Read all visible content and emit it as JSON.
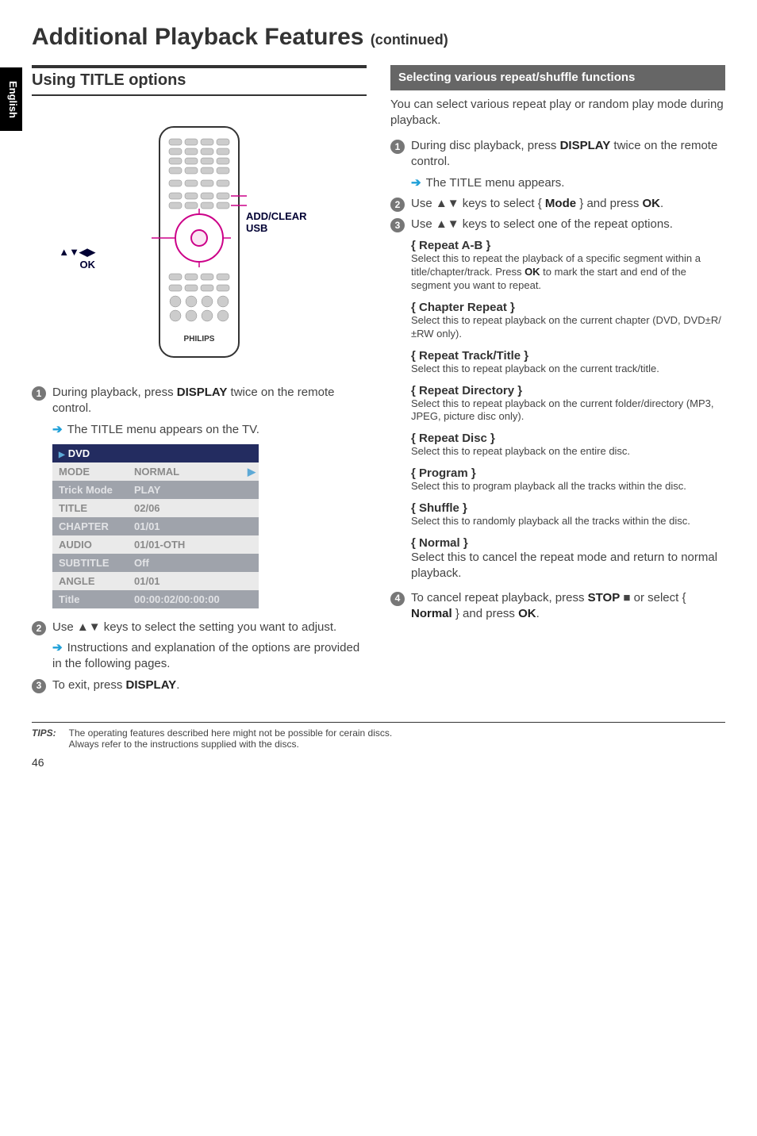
{
  "sideTab": "English",
  "pageTitle": "Additional Playback Features",
  "pageTitleCont": "(continued)",
  "left": {
    "heading": "Using TITLE options",
    "labelRight1": "ADD/CLEAR",
    "labelRight2": "USB",
    "labelLeft1": "▲▼◀▶",
    "labelLeft2": "OK",
    "remoteBrand": "PHILIPS",
    "step1_a": "During playback, press ",
    "step1_b": "DISPLAY",
    "step1_c": " twice on the remote control.",
    "step1_sub": "The TITLE menu appears on the TV.",
    "table": {
      "hdr": "DVD",
      "rows": [
        {
          "k": "MODE",
          "v": "NORMAL",
          "cls": "dvd-row-light",
          "arrow": true
        },
        {
          "k": "Trick Mode",
          "v": "PLAY",
          "cls": "dvd-row-dark"
        },
        {
          "k": "TITLE",
          "v": "02/06",
          "cls": "dvd-row-light"
        },
        {
          "k": "CHAPTER",
          "v": "01/01",
          "cls": "dvd-row-dark"
        },
        {
          "k": "AUDIO",
          "v": "01/01-OTH",
          "cls": "dvd-row-light"
        },
        {
          "k": "SUBTITLE",
          "v": "Off",
          "cls": "dvd-row-dark"
        },
        {
          "k": "ANGLE",
          "v": "01/01",
          "cls": "dvd-row-light"
        },
        {
          "k": "Title",
          "v": "00:00:02/00:00:00",
          "cls": "dvd-row-dark"
        }
      ]
    },
    "step2_a": "Use ▲▼ keys to select the setting you want to adjust.",
    "step2_sub": "Instructions and explanation of the options are provided in the following pages.",
    "step3_a": "To exit, press ",
    "step3_b": "DISPLAY",
    "step3_c": "."
  },
  "right": {
    "subhead": "Selecting various repeat/shuffle functions",
    "intro": "You can select various repeat play or random play mode during playback.",
    "step1_a": "During disc playback, press ",
    "step1_b": "DISPLAY",
    "step1_c": " twice on the remote control.",
    "step1_sub": "The TITLE menu appears.",
    "step2_a": "Use ▲▼ keys to select { ",
    "step2_b": "Mode",
    "step2_c": " } and press ",
    "step2_d": "OK",
    "step2_e": ".",
    "step3": "Use ▲▼ keys to select one of the repeat options.",
    "opts": [
      {
        "t": "{ Repeat A-B }",
        "d": "Select this to repeat the playback of a specific segment within a title/chapter/track. Press OK to mark the start and end of the segment you want to repeat.",
        "lg": false,
        "bold": "OK"
      },
      {
        "t": "{ Chapter Repeat }",
        "d": "Select this to repeat playback on the current chapter (DVD, DVD±R/±RW only).",
        "lg": false
      },
      {
        "t": "{ Repeat Track/Title }",
        "d": "Select this to repeat playback on the current track/title.",
        "lg": false
      },
      {
        "t": "{ Repeat Directory }",
        "d": "Select this to repeat playback on the current folder/directory (MP3, JPEG, picture disc only).",
        "lg": false
      },
      {
        "t": "{ Repeat Disc }",
        "d": "Select this to repeat playback on the entire disc.",
        "lg": false
      },
      {
        "t": "{ Program }",
        "d": "Select this to program playback all the tracks within the disc.",
        "lg": false
      },
      {
        "t": "{ Shuffle }",
        "d": "Select this to randomly playback all the tracks within the disc.",
        "lg": false
      },
      {
        "t": "{ Normal }",
        "d": "Select this to cancel the repeat mode and return to normal playback.",
        "lg": true
      }
    ],
    "step4_a": "To cancel repeat playback, press ",
    "step4_b": "STOP",
    "step4_stop": "■",
    "step4_c": " or select { ",
    "step4_d": "Normal",
    "step4_e": " } and press ",
    "step4_f": "OK",
    "step4_g": "."
  },
  "tipsLabel": "TIPS:",
  "tipsText1": "The operating features described here might not be possible for cerain discs.",
  "tipsText2": "Always refer to the instructions supplied with the discs.",
  "pageNum": "46"
}
